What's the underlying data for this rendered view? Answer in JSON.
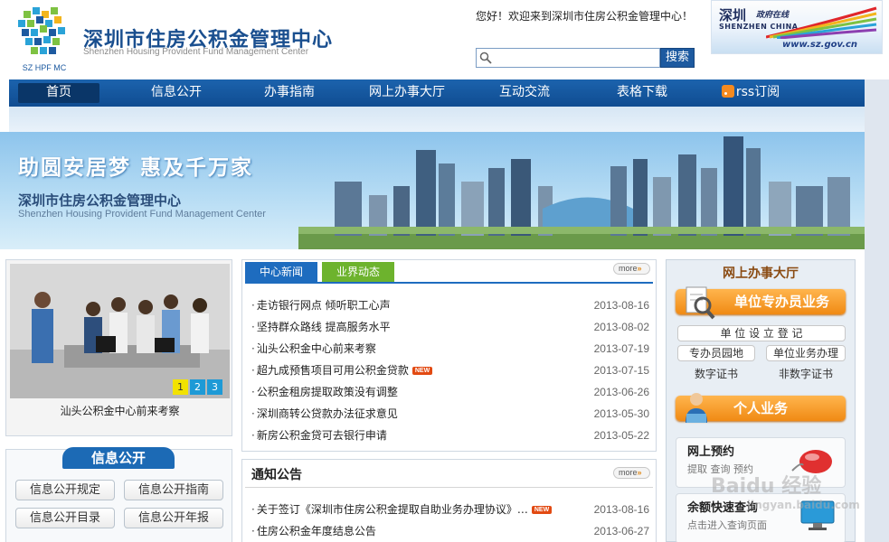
{
  "header": {
    "title": "深圳市住房公积金管理中心",
    "subtitle": "Shenzhen Housing Provident Fund Management Center",
    "logo_text": "SZ HPF MC",
    "welcome": "您好！欢迎来到深圳市住房公积金管理中心！",
    "search_placeholder": "",
    "search_button": "搜索",
    "gov_banner": {
      "cn": "深圳",
      "cn2": "政府在线",
      "en": "SHENZHEN CHINA",
      "url": "www.sz.gov.cn"
    }
  },
  "nav": {
    "items": [
      "首页",
      "信息公开",
      "办事指南",
      "网上办事大厅",
      "互动交流",
      "表格下载",
      "rss订阅"
    ],
    "active_index": 0
  },
  "banner": {
    "slogan": "助圆安居梦 惠及千万家",
    "cn": "深圳市住房公积金管理中心",
    "en": "Shenzhen Housing Provident Fund Management Center"
  },
  "photo": {
    "caption": "汕头公积金中心前来考察",
    "slides": [
      "1",
      "2",
      "3"
    ],
    "active_slide": 0
  },
  "info_public": {
    "title": "信息公开",
    "buttons": [
      "信息公开规定",
      "信息公开指南",
      "信息公开目录",
      "信息公开年报"
    ]
  },
  "news": {
    "tabs": [
      "中心新闻",
      "业界动态"
    ],
    "more": "more",
    "items": [
      {
        "title": "走访银行网点 倾听职工心声",
        "date": "2013-08-16",
        "new": false
      },
      {
        "title": "坚持群众路线 提高服务水平",
        "date": "2013-08-02",
        "new": false
      },
      {
        "title": "汕头公积金中心前来考察",
        "date": "2013-07-19",
        "new": false
      },
      {
        "title": "超九成预售项目可用公积金贷款",
        "date": "2013-07-15",
        "new": true
      },
      {
        "title": "公积金租房提取政策没有调整",
        "date": "2013-06-26",
        "new": false
      },
      {
        "title": "深圳商转公贷款办法征求意见",
        "date": "2013-05-30",
        "new": false
      },
      {
        "title": "新房公积金贷可去银行申请",
        "date": "2013-05-22",
        "new": false
      }
    ],
    "new_label": "NEW"
  },
  "notice": {
    "title": "通知公告",
    "more": "more",
    "items": [
      {
        "title": "关于签订《深圳市住房公积金提取自助业务办理协议》…",
        "date": "2013-08-16",
        "new": true
      },
      {
        "title": "住房公积金年度结息公告",
        "date": "2013-06-27",
        "new": false
      }
    ]
  },
  "online_hall": {
    "title": "网上办事大厅",
    "unit_button": "单位专办员业务",
    "unit_links": [
      "单 位 设 立 登 记",
      "专办员园地",
      "单位业务办理",
      "数字证书",
      "非数字证书"
    ],
    "personal_button": "个人业务",
    "cards": [
      {
        "title": "网上预约",
        "sub": "提取 查询 预约"
      },
      {
        "title": "余额快速查询",
        "sub": "点击进入查询页面"
      }
    ]
  },
  "watermark": {
    "main": "Baidu 经验",
    "sub": "jingyan.baidu.com"
  }
}
